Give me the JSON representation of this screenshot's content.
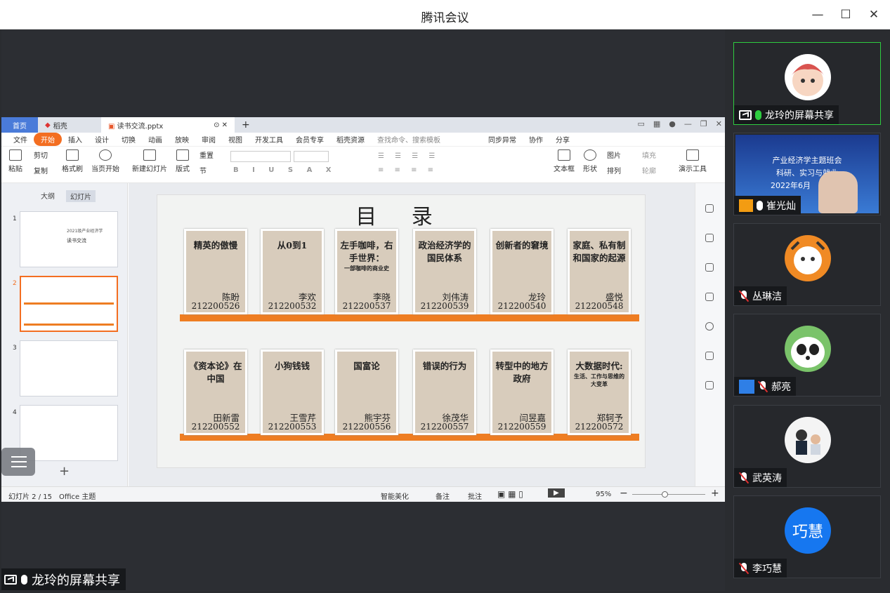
{
  "window": {
    "title": "腾讯会议"
  },
  "share_label": "龙玲的屏幕共享",
  "wps": {
    "tabs": {
      "home": "首页",
      "daoke": "稻壳",
      "file": "读书交流.pptx"
    },
    "menu": [
      "文件",
      "开始",
      "插入",
      "设计",
      "切换",
      "动画",
      "放映",
      "审阅",
      "视图",
      "开发工具",
      "会员专享",
      "稻壳资源",
      "查找命令、搜索模板",
      "同步异常",
      "协作",
      "分享"
    ],
    "ribbon": {
      "cut": "剪切",
      "paste": "粘贴",
      "copy": "复制",
      "format": "格式刷",
      "play": "当页开始",
      "newslide": "新建幻灯片",
      "layout": "版式",
      "reset": "重置",
      "section": "节",
      "textbox": "文本框",
      "shape": "形状",
      "picture": "图片",
      "arrange": "排列",
      "fill": "填充",
      "outline": "轮廓",
      "present": "演示工具"
    },
    "sidebar": {
      "outline": "大纲",
      "slides": "幻灯片",
      "numbers": [
        "1",
        "2",
        "3",
        "4"
      ],
      "thumb1_line1": "2021级产业经济学",
      "thumb1_line2": "读书交流"
    },
    "slide": {
      "title": "目 录",
      "row1": [
        {
          "t": "精英的傲慢",
          "sub": "",
          "name": "陈盼",
          "id": "212200526"
        },
        {
          "t": "从0到1",
          "sub": "",
          "name": "李欢",
          "id": "212200532"
        },
        {
          "t": "左手咖啡，右手世界：",
          "sub": "一部咖啡的商业史",
          "name": "李晓",
          "id": "212200537"
        },
        {
          "t": "政治经济学的国民体系",
          "sub": "",
          "name": "刘伟涛",
          "id": "212200539"
        },
        {
          "t": "创新者的窘境",
          "sub": "",
          "name": "龙玲",
          "id": "212200540"
        },
        {
          "t": "家庭、私有制和国家的起源",
          "sub": "",
          "name": "盛悦",
          "id": "212200548"
        }
      ],
      "row2": [
        {
          "t": "《资本论》在中国",
          "sub": "",
          "name": "田新雷",
          "id": "212200552"
        },
        {
          "t": "小狗钱钱",
          "sub": "",
          "name": "王雪芹",
          "id": "212200553"
        },
        {
          "t": "国富论",
          "sub": "",
          "name": "熊宇芬",
          "id": "212200556"
        },
        {
          "t": "错误的行为",
          "sub": "",
          "name": "徐茂华",
          "id": "212200557"
        },
        {
          "t": "转型中的地方政府",
          "sub": "",
          "name": "闫昱嘉",
          "id": "212200559"
        },
        {
          "t": "大数据时代:",
          "sub": "生活、工作与思维的大变革",
          "name": "郑轲予",
          "id": "212200572"
        }
      ]
    },
    "status": {
      "page": "幻灯片 2 / 15",
      "theme": "Office 主题",
      "beautify": "智能美化",
      "notes": "备注",
      "comment": "批注",
      "zoom": "95%"
    }
  },
  "participants": [
    {
      "name": "龙玲的屏幕共享",
      "mic": "on"
    },
    {
      "name": "崔光灿",
      "mic": "on",
      "banner_l1": "产业经济学主题班会",
      "banner_l2": "科研、实习与就业",
      "banner_l3": "2022年6月"
    },
    {
      "name": "丛琳洁",
      "mic": "off"
    },
    {
      "name": "郝亮",
      "mic": "off"
    },
    {
      "name": "武英涛",
      "mic": "off"
    },
    {
      "name": "李巧慧",
      "mic": "off",
      "initials": "巧慧"
    }
  ]
}
